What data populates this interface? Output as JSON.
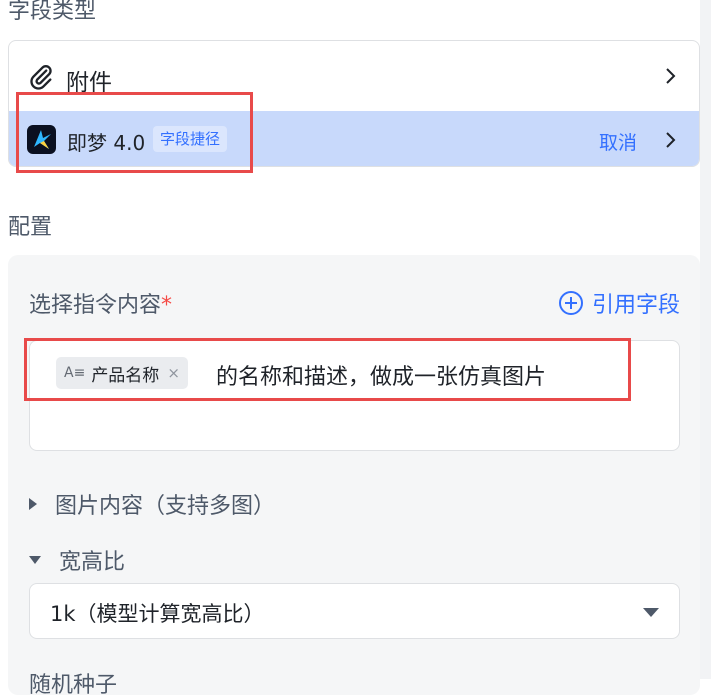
{
  "field_type": {
    "section_label": "字段类型",
    "attachment": {
      "label": "附件",
      "icon": "paperclip-icon"
    },
    "jimeng": {
      "label": "即梦 4.0",
      "tag": "字段捷径",
      "cancel": "取消",
      "icon": "jimeng-logo"
    }
  },
  "config": {
    "section_label": "配置",
    "instruction": {
      "label": "选择指令内容",
      "required_mark": "*",
      "reference_button": "引用字段",
      "chip": {
        "type_icon": "A≡",
        "label": "产品名称",
        "close": "×"
      },
      "text": "的名称和描述，做成一张仿真图片"
    },
    "image_content": {
      "label": "图片内容（支持多图）",
      "expanded": false
    },
    "aspect_ratio": {
      "label": "宽高比",
      "expanded": true,
      "selected": "1k（模型计算宽高比）"
    },
    "next_row_partial": "随机种子"
  },
  "colors": {
    "accent": "#3370ff",
    "highlight_row": "#c8d9fb",
    "annotation_red": "#e84a4a",
    "panel_bg": "#f5f6f7"
  }
}
